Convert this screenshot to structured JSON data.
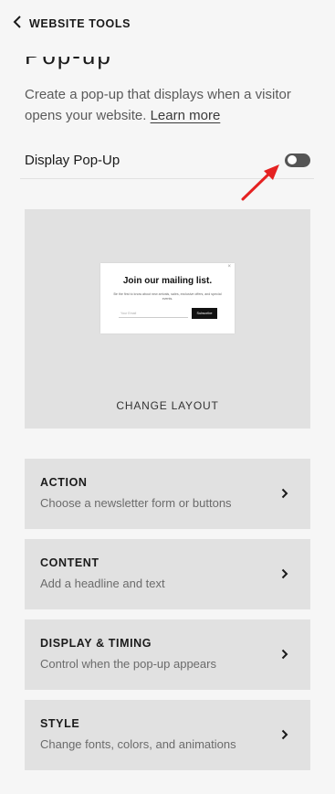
{
  "header": {
    "back_label": "WEBSITE TOOLS"
  },
  "page": {
    "title_partial": "Pop-up",
    "description": "Create a pop-up that displays when a visitor opens your website.",
    "learn_more": "Learn more"
  },
  "toggle": {
    "label": "Display Pop-Up",
    "state": "off"
  },
  "layout": {
    "preview": {
      "headline": "Join our mailing list.",
      "subtext": "Be the first to know about new arrivals, sales, exclusive offers, and special events.",
      "input_placeholder": "Your Email",
      "button": "Subscribe",
      "close": "×"
    },
    "label": "CHANGE LAYOUT"
  },
  "options": [
    {
      "title": "ACTION",
      "description": "Choose a newsletter form or buttons"
    },
    {
      "title": "CONTENT",
      "description": "Add a headline and text"
    },
    {
      "title": "DISPLAY & TIMING",
      "description": "Control when the pop-up appears"
    },
    {
      "title": "STYLE",
      "description": "Change fonts, colors, and animations"
    }
  ],
  "colors": {
    "background": "#f6f6f6",
    "card": "#e1e1e1",
    "toggle_off": "#555555",
    "annotation_arrow": "#e52222"
  }
}
